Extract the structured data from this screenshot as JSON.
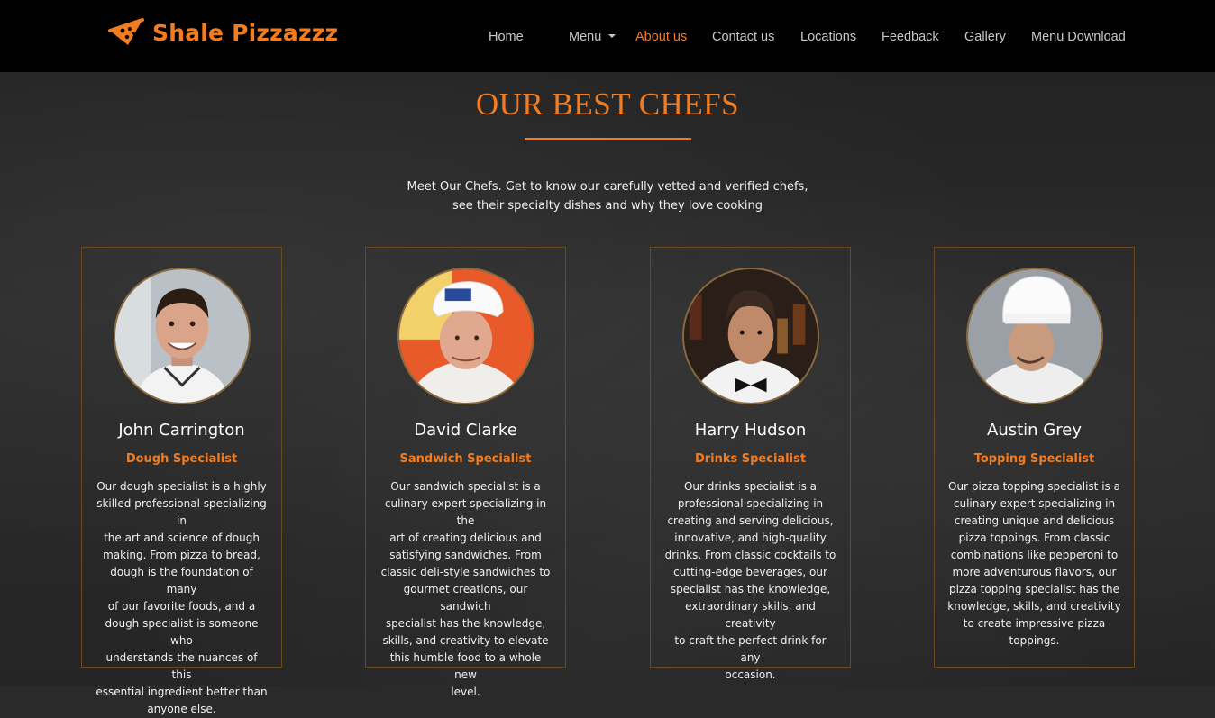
{
  "brand": {
    "name": "Shale Pizzazzz",
    "icon": "pizza-slice-icon",
    "color": "#f47c20"
  },
  "nav": {
    "home": "Home",
    "menu": "Menu",
    "about": "About us",
    "contact": "Contact us",
    "locations": "Locations",
    "feedback": "Feedback",
    "gallery": "Gallery",
    "download": "Menu Download",
    "active": "About us"
  },
  "section": {
    "title": "OUR BEST CHEFS",
    "intro_line1": "Meet Our Chefs. Get to know our carefully vetted and verified chefs,",
    "intro_line2": "see their specialty dishes and why they love cooking"
  },
  "chefs": [
    {
      "name": "John Carrington",
      "role": "Dough Specialist",
      "desc": [
        "Our dough specialist is a highly",
        "skilled professional specializing in",
        "the art and science of dough",
        "making. From pizza to bread,",
        "dough is the foundation of many",
        "of our favorite foods, and a",
        "dough specialist is someone who",
        "understands the nuances of this",
        "essential ingredient better than",
        "anyone else."
      ]
    },
    {
      "name": "David Clarke",
      "role": "Sandwich Specialist",
      "desc": [
        "Our sandwich specialist is a",
        "culinary expert specializing in the",
        "art of creating delicious and",
        "satisfying sandwiches. From",
        "classic deli-style sandwiches to",
        "gourmet creations, our sandwich",
        "specialist has the knowledge,",
        "skills, and creativity to elevate",
        "this humble food to a whole new",
        "level."
      ]
    },
    {
      "name": "Harry Hudson",
      "role": "Drinks Specialist",
      "desc": [
        "Our drinks specialist is a",
        "professional specializing in",
        "creating and serving delicious,",
        "innovative, and high-quality",
        "drinks. From classic cocktails to",
        "cutting-edge beverages, our",
        "specialist has the knowledge,",
        "extraordinary skills, and creativity",
        "to craft the perfect drink for any",
        "occasion."
      ]
    },
    {
      "name": "Austin Grey",
      "role": "Topping Specialist",
      "desc": [
        "Our pizza topping specialist is a",
        "culinary expert specializing in",
        "creating unique and delicious",
        "pizza toppings. From classic",
        "combinations like pepperoni to",
        "more adventurous flavors, our",
        "pizza topping specialist has the",
        "knowledge, skills, and creativity",
        "to create impressive pizza",
        "toppings."
      ]
    }
  ]
}
